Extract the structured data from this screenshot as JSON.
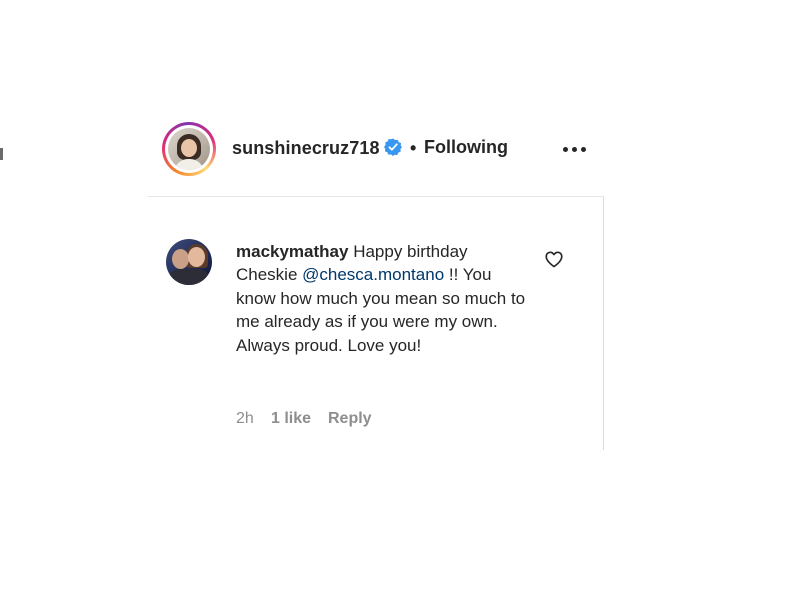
{
  "post_header": {
    "username": "sunshinecruz718",
    "separator": "•",
    "follow_status": "Following",
    "verified": true,
    "more_icon": "more-horizontal-icon"
  },
  "comment": {
    "author": "mackymathay",
    "text_before_mention": " Happy birthday Cheskie ",
    "mention": "@chesca.montano",
    "text_after_mention": " !! You know how much you mean so much to me already as if you were my own. Always proud. Love you!",
    "time": "2h",
    "likes": "1 like",
    "reply_label": "Reply",
    "like_icon": "heart-outline-icon"
  },
  "colors": {
    "text": "#262626",
    "muted": "#8e8e8e",
    "mention": "#00376b",
    "verified_badge": "#3897f0"
  }
}
